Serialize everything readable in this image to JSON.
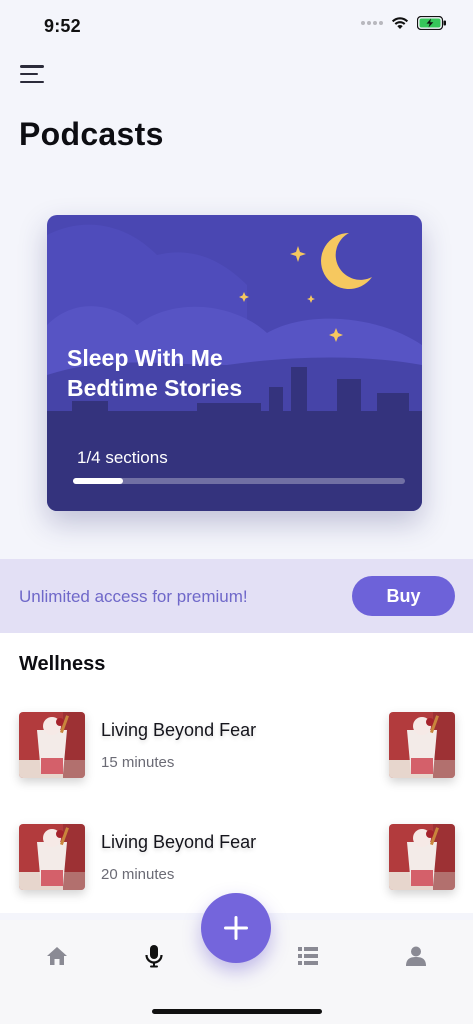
{
  "status_bar": {
    "time": "9:52"
  },
  "header": {
    "title": "Podcasts"
  },
  "featured": {
    "title_line1": "Sleep With Me",
    "title_line2": "Bedtime Stories",
    "progress_label": "1/4 sections",
    "progress_fraction": 0.15,
    "colors": {
      "sky": "#4a47b2",
      "cloud": "#5452c0",
      "city": "#34337d",
      "moon": "#f6c85f"
    }
  },
  "premium": {
    "text": "Unlimited access for premium!",
    "buy_label": "Buy",
    "accent": "#6d62d9"
  },
  "wellness": {
    "section_title": "Wellness",
    "episodes": [
      {
        "title": "Living Beyond Fear",
        "duration": "15 minutes"
      },
      {
        "title": "Living Beyond Fear",
        "duration": "20 minutes"
      }
    ]
  },
  "tab_bar": {
    "tabs": [
      "home-icon",
      "microphone-icon",
      "add-icon",
      "list-icon",
      "profile-icon"
    ],
    "active": "microphone-icon",
    "fab_color": "#7465dc"
  }
}
